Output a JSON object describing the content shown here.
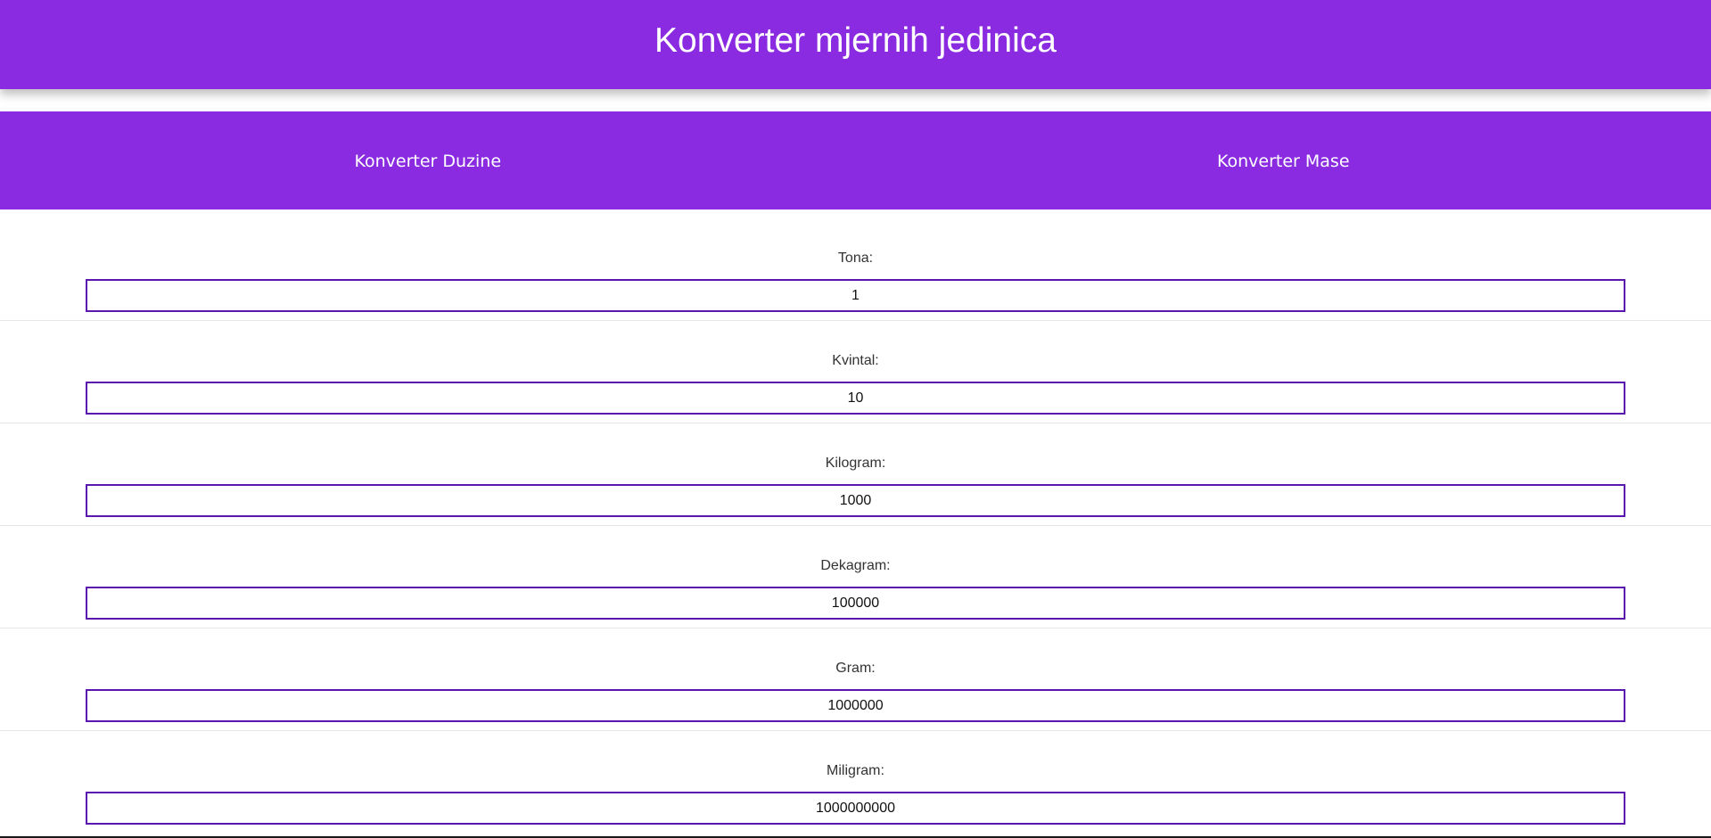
{
  "header": {
    "title": "Konverter mjernih jedinica"
  },
  "nav": {
    "items": [
      {
        "label": "Konverter Duzine"
      },
      {
        "label": "Konverter Mase"
      }
    ]
  },
  "fields": [
    {
      "label": "Tona:",
      "value": "1"
    },
    {
      "label": "Kvintal:",
      "value": "10"
    },
    {
      "label": "Kilogram:",
      "value": "1000"
    },
    {
      "label": "Dekagram:",
      "value": "100000"
    },
    {
      "label": "Gram:",
      "value": "1000000"
    },
    {
      "label": "Miligram:",
      "value": "1000000000"
    }
  ],
  "colors": {
    "primary": "#8a2be2",
    "input_border": "#5a17b0"
  }
}
